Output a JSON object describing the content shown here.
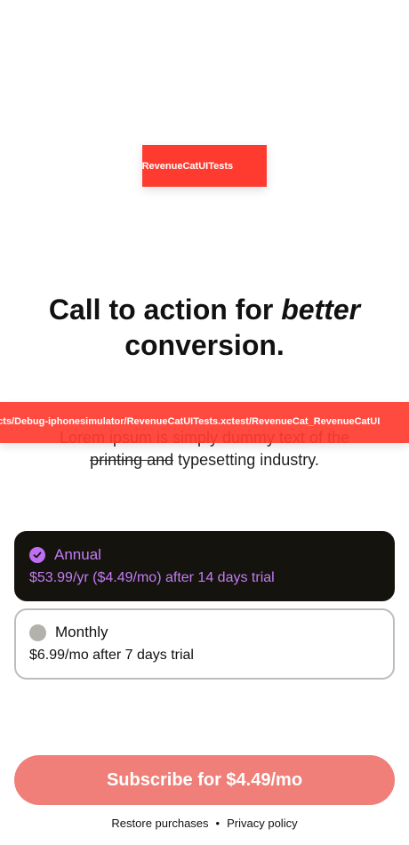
{
  "banners": {
    "top_text": "ulator/RevenueCatUITests",
    "middle_text": "oducts/Debug-iphonesimulator/RevenueCatUITests.xctest/RevenueCat_RevenueCatUI"
  },
  "header": {
    "title_part1": "Call to action for ",
    "title_emphasis": "better",
    "title_part2": "conversion."
  },
  "subtitle": {
    "line1": "Lorem ipsum is simply dummy text of the",
    "strikethrough": "printing and",
    "line2_rest": " typesetting industry."
  },
  "packages": [
    {
      "name": "Annual",
      "price": "$53.99/yr ($4.49/mo) after 14 days trial",
      "selected": true
    },
    {
      "name": "Monthly",
      "price": "$6.99/mo after 7 days trial",
      "selected": false
    }
  ],
  "subscribe_button": {
    "label": "Subscribe for $4.49/mo"
  },
  "footer": {
    "restore": "Restore purchases",
    "separator": "•",
    "privacy": "Privacy policy"
  },
  "colors": {
    "accent": "#c47cf5",
    "selected_bg": "#14130d",
    "button": "#ef7f78",
    "banner": "#ff3b30"
  },
  "icons": {
    "selected": "checkmark-circle-icon",
    "unselected": "empty-circle-icon"
  }
}
